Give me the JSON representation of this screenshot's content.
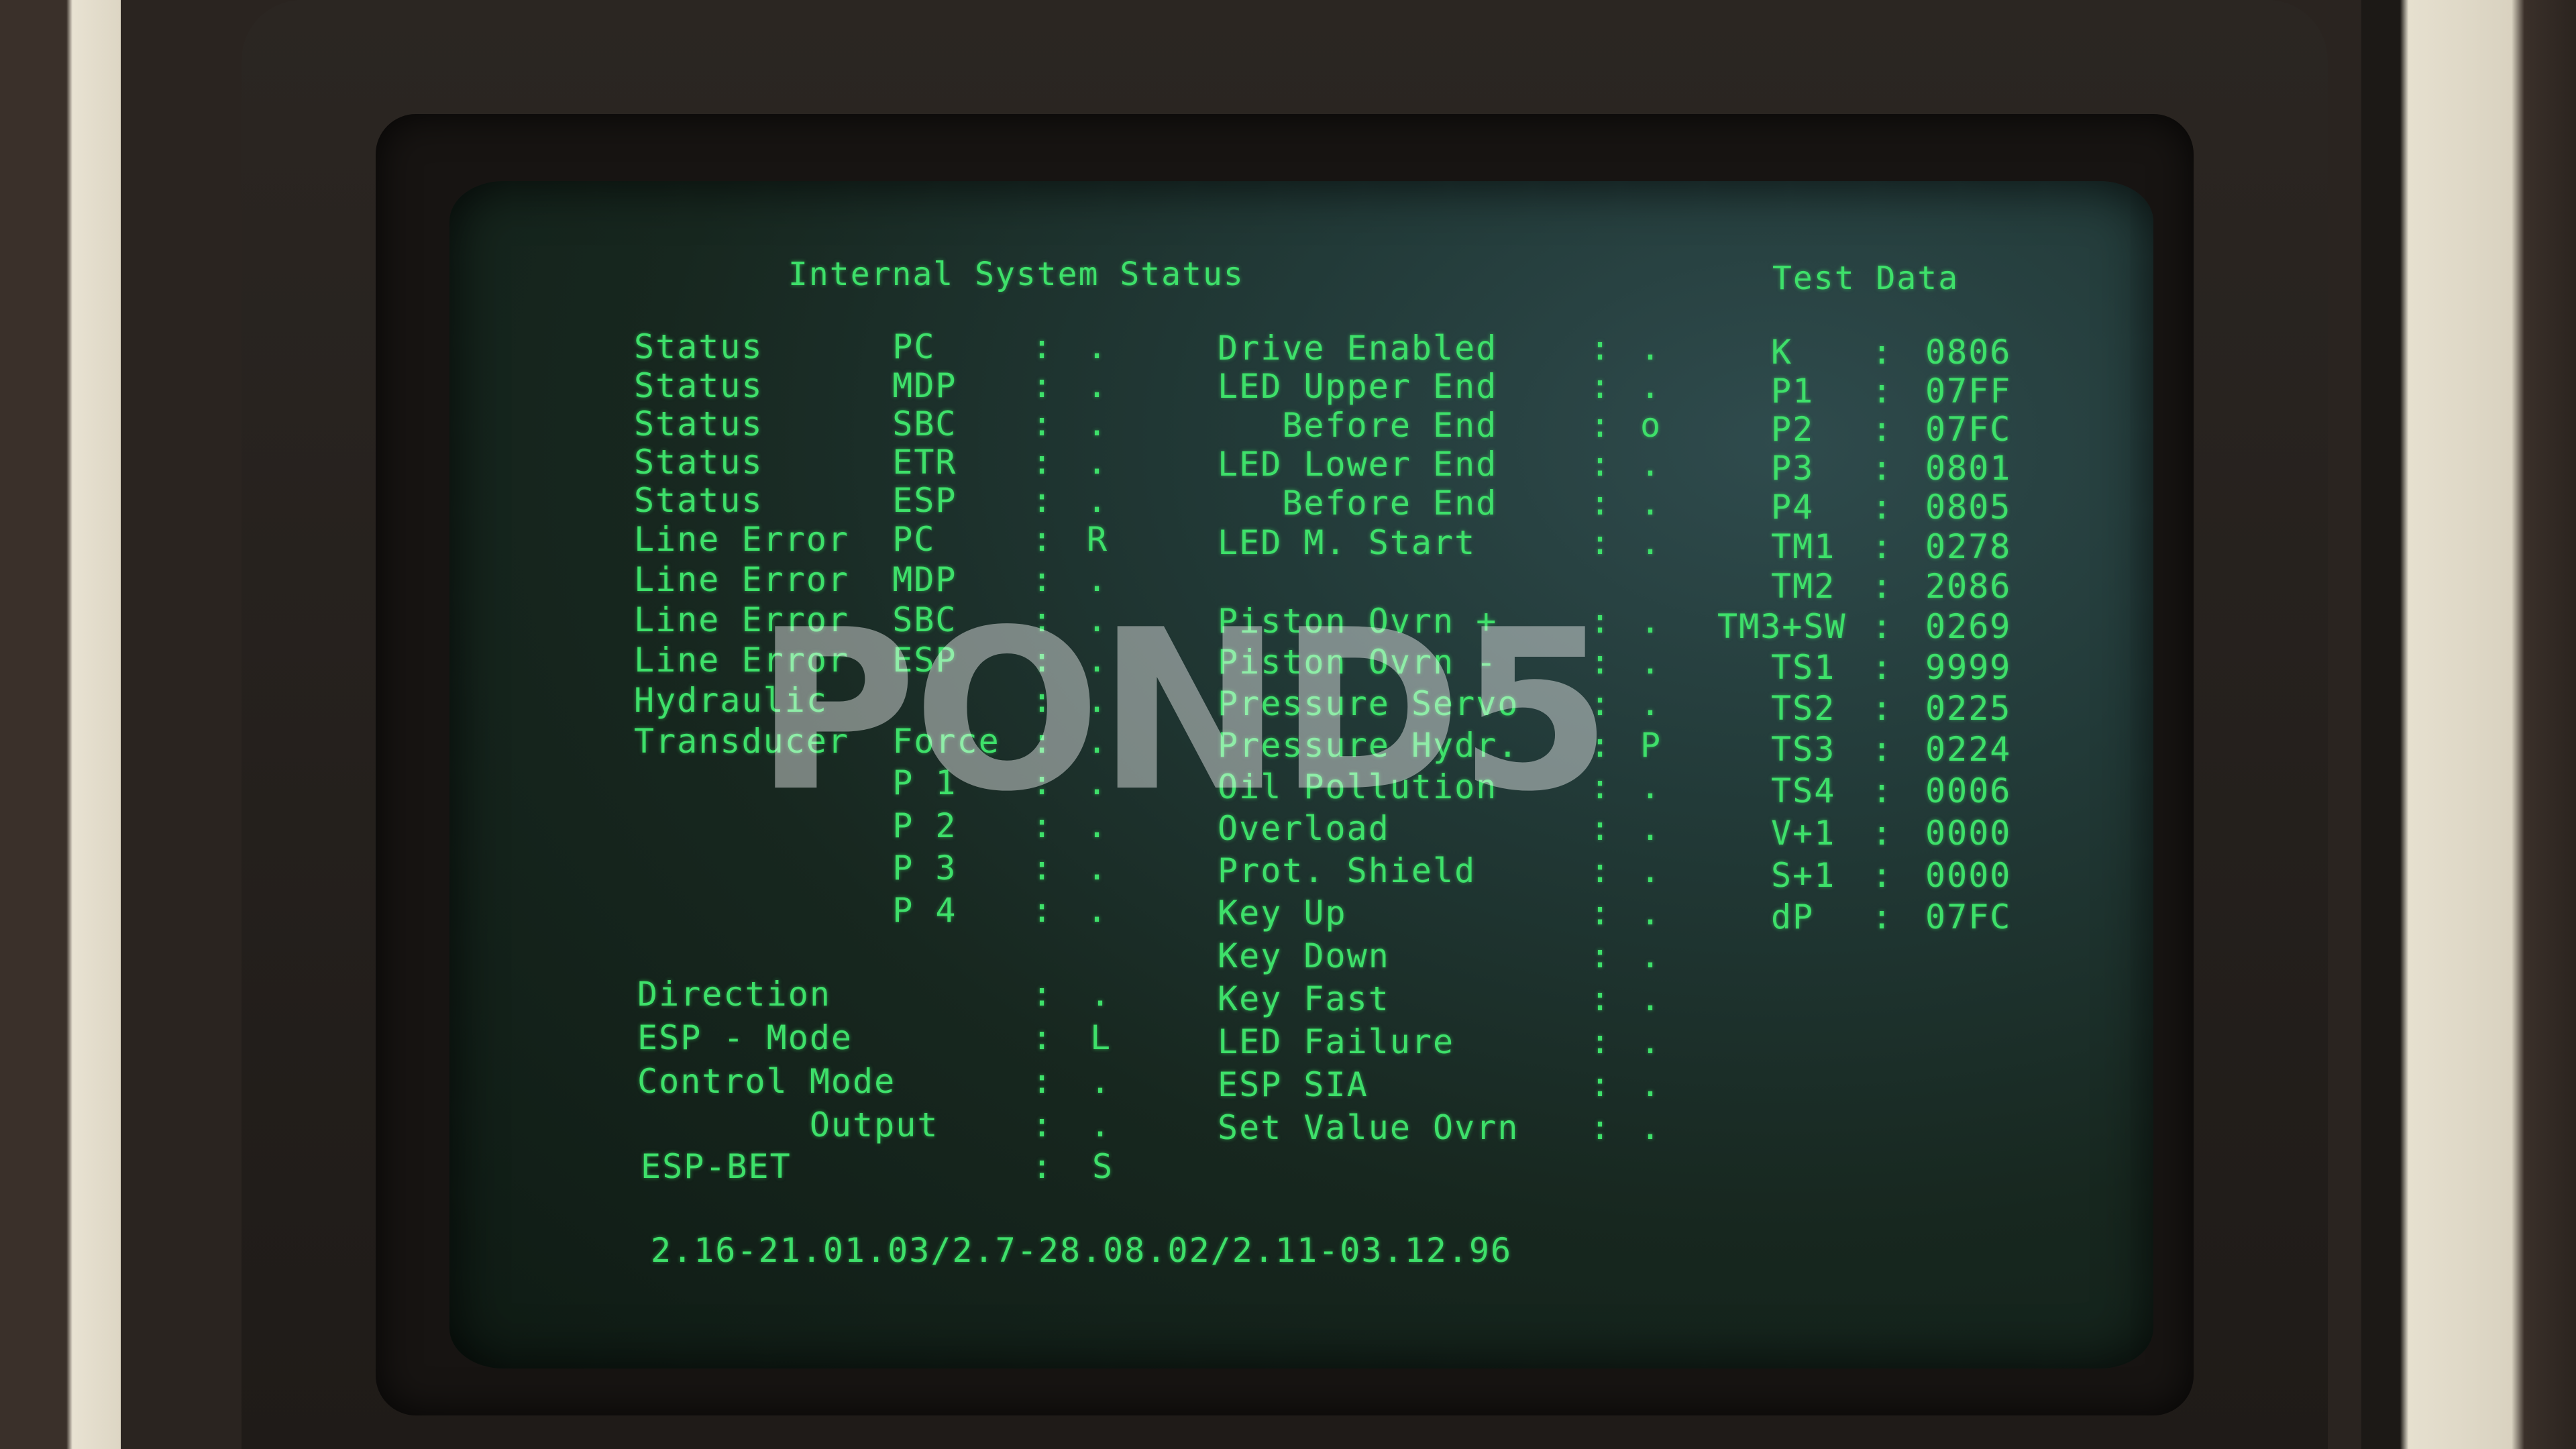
{
  "screen": {
    "title": "Internal System Status",
    "test_data_title": "Test Data",
    "left_rows": [
      {
        "label": "Status      PC",
        "sep": ":",
        "value": "."
      },
      {
        "label": "Status      MDP",
        "sep": ":",
        "value": "."
      },
      {
        "label": "Status      SBC",
        "sep": ":",
        "value": "."
      },
      {
        "label": "Status      ETR",
        "sep": ":",
        "value": "."
      },
      {
        "label": "Status      ESP",
        "sep": ":",
        "value": "."
      },
      {
        "label": "Line Error  PC",
        "sep": ":",
        "value": "R"
      },
      {
        "label": "Line Error  MDP",
        "sep": ":",
        "value": "."
      },
      {
        "label": "Line Error  SBC",
        "sep": ":",
        "value": "."
      },
      {
        "label": "Line Error  ESP",
        "sep": ":",
        "value": "."
      },
      {
        "label": "Hydraulic",
        "sep": ":",
        "value": "."
      },
      {
        "label": "Transducer  Force",
        "sep": ":",
        "value": "."
      },
      {
        "label": "            P 1",
        "sep": ":",
        "value": "."
      },
      {
        "label": "            P 2",
        "sep": ":",
        "value": "."
      },
      {
        "label": "            P 3",
        "sep": ":",
        "value": "."
      },
      {
        "label": "            P 4",
        "sep": ":",
        "value": "."
      }
    ],
    "lower_left_rows": [
      {
        "label": "Direction",
        "sep": ":",
        "value": "."
      },
      {
        "label": "ESP - Mode",
        "sep": ":",
        "value": "L"
      },
      {
        "label": "Control Mode",
        "sep": ":",
        "value": "."
      },
      {
        "label": "        Output",
        "sep": ":",
        "value": "."
      },
      {
        "label": "ESP-BET",
        "sep": ":",
        "value": "S"
      }
    ],
    "middle_rows": [
      {
        "label": "Drive Enabled",
        "sep": ":",
        "value": "."
      },
      {
        "label": "LED Upper End",
        "sep": ":",
        "value": "."
      },
      {
        "label": "   Before End",
        "sep": ":",
        "value": "o"
      },
      {
        "label": "LED Lower End",
        "sep": ":",
        "value": "."
      },
      {
        "label": "   Before End",
        "sep": ":",
        "value": "."
      },
      {
        "label": "LED M. Start",
        "sep": ":",
        "value": "."
      },
      {
        "label": "Piston Ovrn +",
        "sep": ":",
        "value": "."
      },
      {
        "label": "Piston Ovrn -",
        "sep": ":",
        "value": "."
      },
      {
        "label": "Pressure Servo",
        "sep": ":",
        "value": "."
      },
      {
        "label": "Pressure Hydr.",
        "sep": ":",
        "value": "P"
      },
      {
        "label": "Oil Pollution",
        "sep": ":",
        "value": "."
      },
      {
        "label": "Overload",
        "sep": ":",
        "value": "."
      },
      {
        "label": "Prot. Shield",
        "sep": ":",
        "value": "."
      },
      {
        "label": "Key Up",
        "sep": ":",
        "value": "."
      },
      {
        "label": "Key Down",
        "sep": ":",
        "value": "."
      },
      {
        "label": "Key Fast",
        "sep": ":",
        "value": "."
      },
      {
        "label": "LED Failure",
        "sep": ":",
        "value": "."
      },
      {
        "label": "ESP SIA",
        "sep": ":",
        "value": "."
      },
      {
        "label": "Set Value Ovrn",
        "sep": ":",
        "value": "."
      }
    ],
    "test_rows": [
      {
        "label": "K",
        "sep": ":",
        "value": "0806"
      },
      {
        "label": "P1",
        "sep": ":",
        "value": "07FF"
      },
      {
        "label": "P2",
        "sep": ":",
        "value": "07FC"
      },
      {
        "label": "P3",
        "sep": ":",
        "value": "0801"
      },
      {
        "label": "P4",
        "sep": ":",
        "value": "0805"
      },
      {
        "label": "TM1",
        "sep": ":",
        "value": "0278"
      },
      {
        "label": "TM2",
        "sep": ":",
        "value": "2086"
      },
      {
        "label": "TM3+SW",
        "sep": ":",
        "value": "0269"
      },
      {
        "label": "TS1",
        "sep": ":",
        "value": "9999"
      },
      {
        "label": "TS2",
        "sep": ":",
        "value": "0225"
      },
      {
        "label": "TS3",
        "sep": ":",
        "value": "0224"
      },
      {
        "label": "TS4",
        "sep": ":",
        "value": "0006"
      },
      {
        "label": "V+1",
        "sep": ":",
        "value": "0000"
      },
      {
        "label": "S+1",
        "sep": ":",
        "value": "0000"
      },
      {
        "label": "dP",
        "sep": ":",
        "value": "07FC"
      }
    ],
    "footer": "2.16-21.01.03/2.7-28.08.02/2.11-03.12.96"
  },
  "watermark": "POND5",
  "colors": {
    "phosphor": "#3ee06a",
    "screen": "#17271f"
  }
}
